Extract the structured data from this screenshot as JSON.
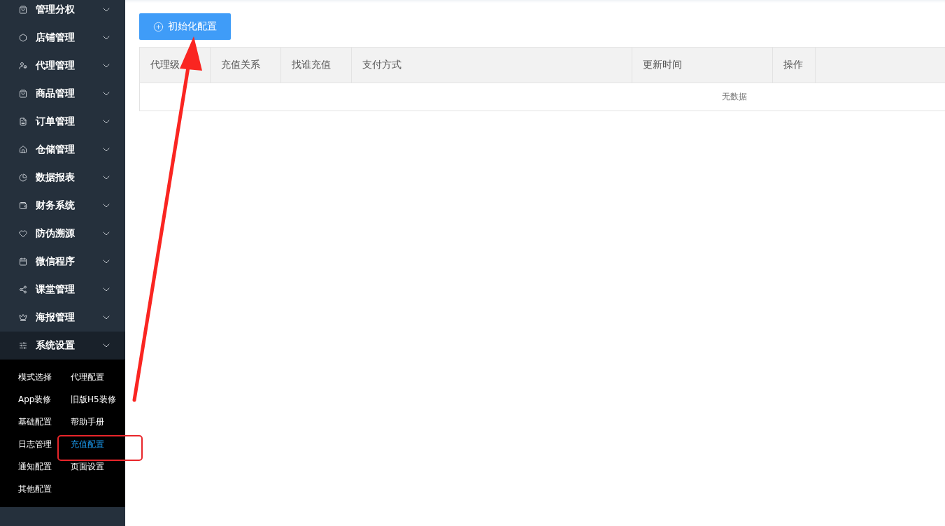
{
  "sidebar": {
    "items": [
      {
        "label": "管理分权",
        "expanded": false
      },
      {
        "label": "店铺管理",
        "expanded": false
      },
      {
        "label": "代理管理",
        "expanded": false
      },
      {
        "label": "商品管理",
        "expanded": false
      },
      {
        "label": "订单管理",
        "expanded": false
      },
      {
        "label": "仓储管理",
        "expanded": false
      },
      {
        "label": "数据报表",
        "expanded": false
      },
      {
        "label": "财务系统",
        "expanded": false
      },
      {
        "label": "防伪溯源",
        "expanded": false
      },
      {
        "label": "微信程序",
        "expanded": false
      },
      {
        "label": "课堂管理",
        "expanded": false
      },
      {
        "label": "海报管理",
        "expanded": false
      },
      {
        "label": "系统设置",
        "expanded": true,
        "children": [
          {
            "label": "模式选择",
            "selected": false
          },
          {
            "label": "代理配置",
            "selected": false
          },
          {
            "label": "App装修",
            "selected": false
          },
          {
            "label": "旧版H5装修",
            "selected": false
          },
          {
            "label": "基础配置",
            "selected": false
          },
          {
            "label": "帮助手册",
            "selected": false
          },
          {
            "label": "日志管理",
            "selected": false
          },
          {
            "label": "充值配置",
            "selected": true
          },
          {
            "label": "通知配置",
            "selected": false
          },
          {
            "label": "页面设置",
            "selected": false
          },
          {
            "label": "其他配置",
            "selected": false
          }
        ]
      }
    ]
  },
  "toolbar": {
    "button": "初始化配置"
  },
  "table": {
    "columns": [
      "代理级",
      "充值关系",
      "找谁充值",
      "支付方式",
      "更新时间",
      "操作"
    ],
    "empty_text": "无数据"
  }
}
